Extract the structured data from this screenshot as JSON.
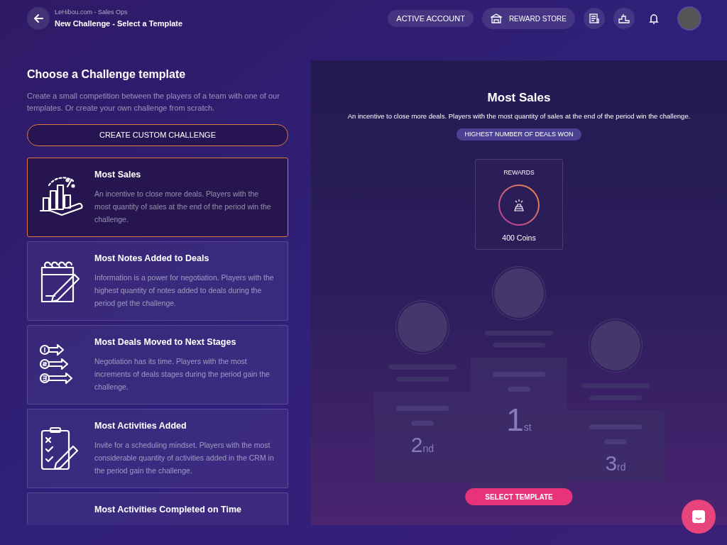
{
  "header": {
    "breadcrumb": "LeHibou.com - Sales Ops",
    "title": "New Challenge - Select a Template",
    "active_account": "ACTIVE ACCOUNT",
    "reward_store": "REWARD STORE"
  },
  "left": {
    "heading": "Choose a Challenge template",
    "intro": "Create a small competition between the players of a team with one of our templates. Or create your own challenge from scratch.",
    "custom_button": "CREATE CUSTOM CHALLENGE"
  },
  "templates": [
    {
      "kind": "sales",
      "title": "Most Sales",
      "description": "An incentive to close more deals. Players with the most quantity of sales at the end of the period win the challenge.",
      "selected": true
    },
    {
      "kind": "notes",
      "title": "Most Notes Added to Deals",
      "description": "Information is a power for negotiation. Players with the highest quantity of notes added to deals during the period get the challenge.",
      "selected": false
    },
    {
      "kind": "stages",
      "title": "Most Deals Moved to Next Stages",
      "description": "Negotiation has its time. Players with the most increments of deals stages during the period gain the challenge.",
      "selected": false
    },
    {
      "kind": "activities",
      "title": "Most Activities Added",
      "description": "Invite for a scheduling mindset. Players with the most considerable quantity of activities added in the CRM in the period gain the challenge.",
      "selected": false
    },
    {
      "kind": "calendar",
      "title": "Most Activities Completed on Time",
      "selected": false
    }
  ],
  "preview": {
    "title": "Most Sales",
    "description": "An incentive to close more deals. Players with the most quantity of sales at the end of the period win the challenge.",
    "metric": "HIGHEST NUMBER OF DEALS WON",
    "rewards_label": "REWARDS",
    "reward": "400 Coins",
    "podium": [
      {
        "rank": "2",
        "suffix": "nd"
      },
      {
        "rank": "1",
        "suffix": "st"
      },
      {
        "rank": "3",
        "suffix": "rd"
      }
    ],
    "select_button": "SELECT TEMPLATE"
  }
}
